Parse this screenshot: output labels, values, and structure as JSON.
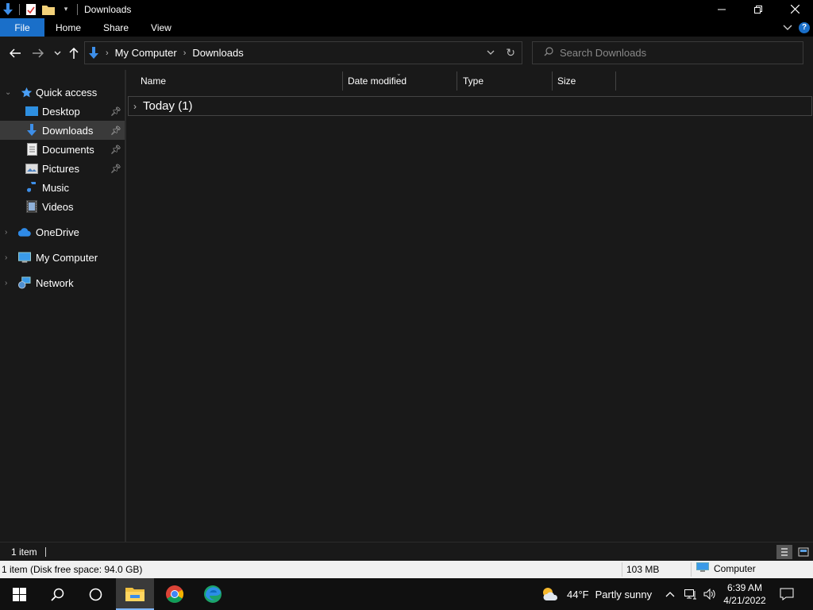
{
  "window": {
    "title": "Downloads"
  },
  "ribbon": {
    "tabs": [
      "File",
      "Home",
      "Share",
      "View"
    ],
    "help_label": "?"
  },
  "address": {
    "crumbs": [
      "My Computer",
      "Downloads"
    ],
    "search_placeholder": "Search Downloads"
  },
  "nav": {
    "quick_access": "Quick access",
    "pinned": [
      "Desktop",
      "Downloads",
      "Documents",
      "Pictures"
    ],
    "unpinned": [
      "Music",
      "Videos"
    ],
    "roots": [
      "OneDrive",
      "My Computer",
      "Network"
    ],
    "selected": "Downloads"
  },
  "columns": [
    "Name",
    "Date modified",
    "Type",
    "Size"
  ],
  "groups": [
    {
      "label": "Today (1)"
    }
  ],
  "status": {
    "item_count": "1 item"
  },
  "details": {
    "summary": "1 item (Disk free space: 94.0 GB)",
    "size": "103 MB",
    "location": "Computer"
  },
  "taskbar": {
    "weather_temp": "44°F",
    "weather_desc": "Partly sunny",
    "time": "6:39 AM",
    "date": "4/21/2022"
  },
  "colors": {
    "accent": "#1a6fc9",
    "background": "#191919",
    "selected": "#3a3a3a"
  }
}
